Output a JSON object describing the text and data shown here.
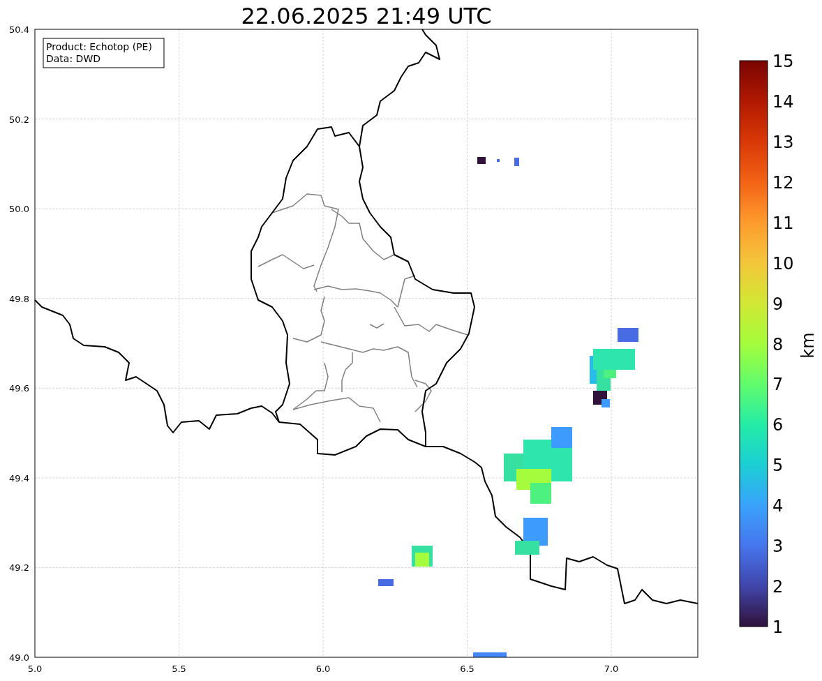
{
  "title": "22.06.2025 21:49 UTC",
  "info_box": [
    "Product: Echotop (PE)",
    "Data: DWD"
  ],
  "x_ticks": [
    "5.0",
    "5.5",
    "6.0",
    "6.5",
    "7.0"
  ],
  "y_ticks": [
    "50.4",
    "50.2",
    "50.0",
    "49.8",
    "49.6",
    "49.4",
    "49.2",
    "49.0"
  ],
  "colorbar": {
    "label": "km",
    "ticks": [
      "15",
      "14",
      "13",
      "12",
      "11",
      "10",
      "9",
      "8",
      "7",
      "6",
      "5",
      "4",
      "3",
      "2",
      "1"
    ]
  }
}
